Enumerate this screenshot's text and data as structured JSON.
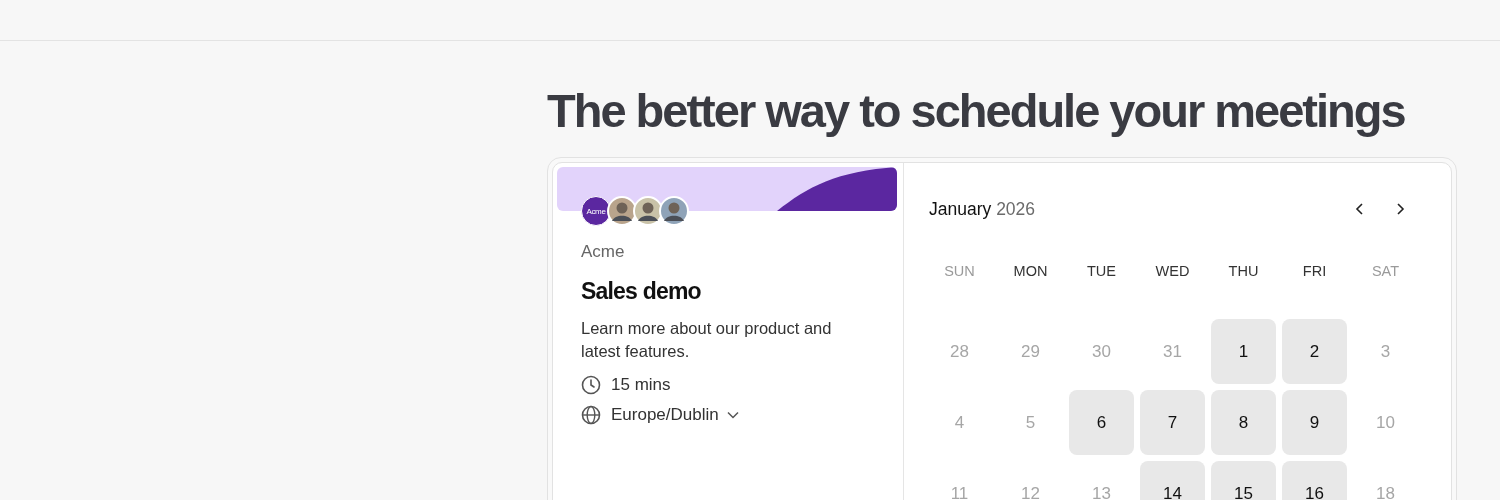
{
  "headline": "The better way to schedule your meetings",
  "event": {
    "logo": "Acme",
    "avatars": [
      {
        "kind": "photo"
      },
      {
        "kind": "photo"
      },
      {
        "kind": "photo"
      }
    ],
    "organizer": "Acme",
    "title": "Sales demo",
    "description": "Learn more about our product and latest features.",
    "duration": "15 mins",
    "timezone": "Europe/Dublin"
  },
  "calendar": {
    "month": "January",
    "year": "2026",
    "weekdays": [
      {
        "label": "SUN",
        "dimmed": true
      },
      {
        "label": "MON",
        "dimmed": false
      },
      {
        "label": "TUE",
        "dimmed": false
      },
      {
        "label": "WED",
        "dimmed": false
      },
      {
        "label": "THU",
        "dimmed": false
      },
      {
        "label": "FRI",
        "dimmed": false
      },
      {
        "label": "SAT",
        "dimmed": true
      }
    ],
    "days": [
      {
        "label": "28",
        "available": false
      },
      {
        "label": "29",
        "available": false
      },
      {
        "label": "30",
        "available": false
      },
      {
        "label": "31",
        "available": false
      },
      {
        "label": "1",
        "available": true
      },
      {
        "label": "2",
        "available": true
      },
      {
        "label": "3",
        "available": false
      },
      {
        "label": "4",
        "available": false
      },
      {
        "label": "5",
        "available": false
      },
      {
        "label": "6",
        "available": true
      },
      {
        "label": "7",
        "available": true
      },
      {
        "label": "8",
        "available": true
      },
      {
        "label": "9",
        "available": true
      },
      {
        "label": "10",
        "available": false
      },
      {
        "label": "11",
        "available": false
      },
      {
        "label": "12",
        "available": false
      },
      {
        "label": "13",
        "available": false
      },
      {
        "label": "14",
        "available": true
      },
      {
        "label": "15",
        "available": true
      },
      {
        "label": "16",
        "available": true
      },
      {
        "label": "18",
        "available": false
      }
    ]
  }
}
